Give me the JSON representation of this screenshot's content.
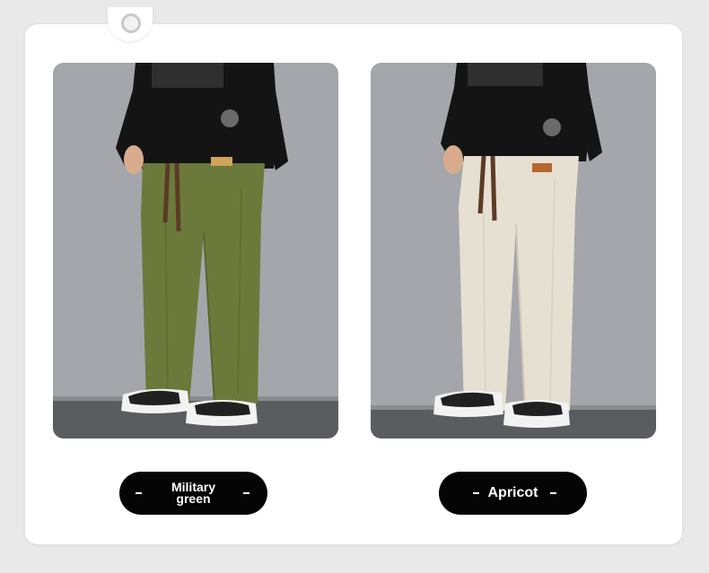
{
  "colors": {
    "background": "#e9e9e9",
    "card": "#ffffff",
    "pill": "#050505",
    "military_green": "#6b7a3a",
    "apricot": "#e6e0d2"
  },
  "products": [
    {
      "color_label_line1": "Military",
      "color_label_line2": "green",
      "swatch": "#6b7a3a"
    },
    {
      "color_label": "Apricot",
      "swatch": "#e6e0d2"
    }
  ]
}
